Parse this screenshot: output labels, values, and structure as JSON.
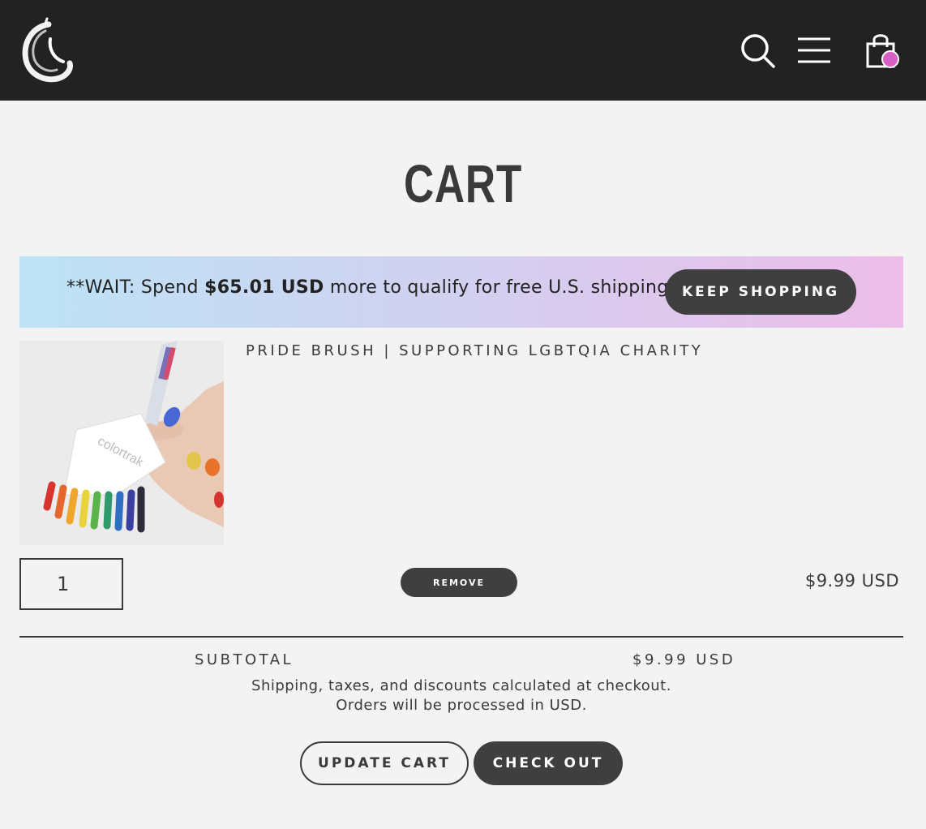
{
  "header": {
    "logo_icon": "brush-stroke-logo",
    "search_icon": "search-icon",
    "menu_icon": "hamburger-menu-icon",
    "cart_icon": "shopping-bag-icon",
    "cart_badge_color": "#d85fc6",
    "background": "#222222"
  },
  "page": {
    "title": "CART"
  },
  "banner": {
    "prefix": "**WAIT: Spend ",
    "amount": "$65.01 USD",
    "suffix": " more to qualify for free U.S. shipping! **",
    "button_label": "KEEP SHOPPING",
    "gradient": [
      "#bde3f6",
      "#d2d0f0",
      "#ecbde8"
    ]
  },
  "cart": {
    "items": [
      {
        "name": "PRIDE BRUSH | SUPPORTING LGBTQIA CHARITY",
        "image_text": "colortrak",
        "quantity": "1",
        "remove_label": "REMOVE",
        "price": "$9.99 USD"
      }
    ],
    "subtotal_label": "SUBTOTAL",
    "subtotal_value": "$9.99 USD",
    "note_line1": "Shipping, taxes, and discounts calculated at checkout.",
    "note_line2": "Orders will be processed in USD.",
    "update_label": "UPDATE CART",
    "checkout_label": "CHECK OUT"
  }
}
